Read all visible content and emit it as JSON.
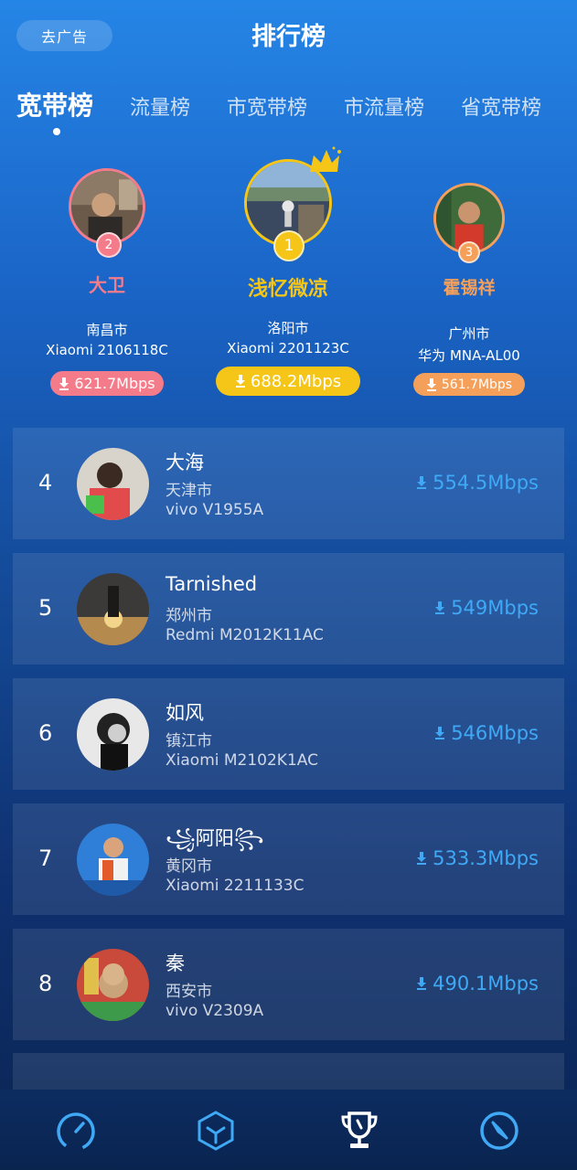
{
  "header": {
    "ad_button": "去广告",
    "title": "排行榜"
  },
  "tabs": [
    {
      "label": "宽带榜",
      "active": true
    },
    {
      "label": "流量榜",
      "active": false
    },
    {
      "label": "市宽带榜",
      "active": false
    },
    {
      "label": "市流量榜",
      "active": false
    },
    {
      "label": "省宽带榜",
      "active": false
    }
  ],
  "podium": {
    "first": {
      "rank": "1",
      "name": "浅忆微凉",
      "city": "洛阳市",
      "device": "Xiaomi 2201123C",
      "speed": "688.2Mbps",
      "color": "#f5c518"
    },
    "second": {
      "rank": "2",
      "name": "大卫",
      "city": "南昌市",
      "device": "Xiaomi 2106118C",
      "speed": "621.7Mbps",
      "color": "#f47c8a"
    },
    "third": {
      "rank": "3",
      "name": "霍锡祥",
      "city": "广州市",
      "device": "华为 MNA-AL00",
      "speed": "561.7Mbps",
      "color": "#f5a05a"
    }
  },
  "rankings": [
    {
      "rank": "4",
      "name": "大海",
      "city": "天津市",
      "device": "vivo V1955A",
      "speed": "554.5Mbps"
    },
    {
      "rank": "5",
      "name": "Tarnished",
      "city": "郑州市",
      "device": "Redmi M2012K11AC",
      "speed": "549Mbps"
    },
    {
      "rank": "6",
      "name": "如风",
      "city": "镇江市",
      "device": "Xiaomi M2102K1AC",
      "speed": "546Mbps"
    },
    {
      "rank": "7",
      "name": "꧁阿阳꧂",
      "city": "黄冈市",
      "device": "Xiaomi 2211133C",
      "speed": "533.3Mbps"
    },
    {
      "rank": "8",
      "name": "秦",
      "city": "西安市",
      "device": "vivo V2309A",
      "speed": "490.1Mbps"
    }
  ],
  "bottom_nav": [
    {
      "icon": "speedometer-icon",
      "active": false
    },
    {
      "icon": "cube-icon",
      "active": false
    },
    {
      "icon": "trophy-icon",
      "active": true
    },
    {
      "icon": "compass-icon",
      "active": false
    }
  ],
  "colors": {
    "accent_blue": "#3fa9f5",
    "gold": "#f5c518",
    "pink": "#f47c8a",
    "orange": "#f5a05a"
  }
}
